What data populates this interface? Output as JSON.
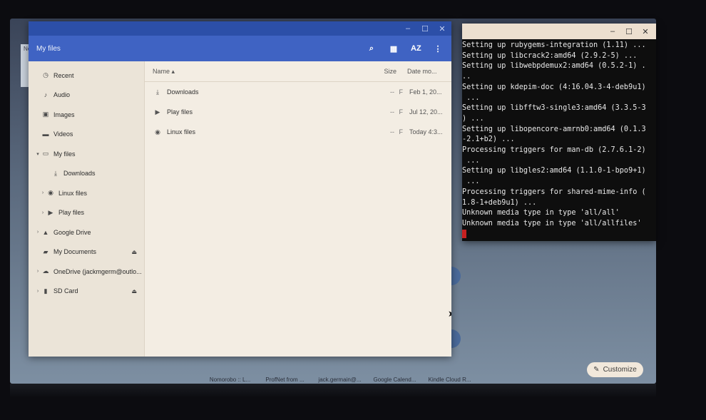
{
  "background": {
    "shelf_items": [
      "Nomorobo :: L...",
      "ProfNet from ...",
      "jack.germain@...",
      "Google Calend...",
      "Kindle Cloud R..."
    ],
    "customize_label": "Customize",
    "strip_label": "Ne"
  },
  "files_app": {
    "title": "My files",
    "window_controls": {
      "minimize": "–",
      "maximize": "☐",
      "close": "✕"
    },
    "toolbar_icons": {
      "search": "⌕",
      "grid": "▦",
      "sort": "AZ",
      "menu": "⋮"
    },
    "sidebar": [
      {
        "label": "Recent",
        "icon": "clock-icon",
        "glyph": "◷",
        "indent": 0,
        "expander": ""
      },
      {
        "label": "Audio",
        "icon": "audio-icon",
        "glyph": "♪",
        "indent": 0,
        "expander": ""
      },
      {
        "label": "Images",
        "icon": "image-icon",
        "glyph": "▣",
        "indent": 0,
        "expander": ""
      },
      {
        "label": "Videos",
        "icon": "video-icon",
        "glyph": "▬",
        "indent": 0,
        "expander": ""
      },
      {
        "label": "My files",
        "icon": "computer-icon",
        "glyph": "▭",
        "indent": 0,
        "expander": "▾",
        "selected": true
      },
      {
        "label": "Downloads",
        "icon": "download-icon",
        "glyph": "⤓",
        "indent": 2,
        "expander": ""
      },
      {
        "label": "Linux files",
        "icon": "linux-icon",
        "glyph": "◉",
        "indent": 1,
        "expander": "›"
      },
      {
        "label": "Play files",
        "icon": "play-icon",
        "glyph": "▶",
        "indent": 1,
        "expander": "›"
      },
      {
        "label": "Google Drive",
        "icon": "drive-icon",
        "glyph": "▲",
        "indent": 0,
        "expander": "›"
      },
      {
        "label": "My Documents",
        "icon": "folder-icon",
        "glyph": "▰",
        "indent": 0,
        "expander": "",
        "eject": "⏏"
      },
      {
        "label": "OneDrive (jackmgerm@outlo...",
        "icon": "cloud-icon",
        "glyph": "☁",
        "indent": 0,
        "expander": "›"
      },
      {
        "label": "SD Card",
        "icon": "sd-card-icon",
        "glyph": "▮",
        "indent": 0,
        "expander": "›",
        "eject": "⏏"
      }
    ],
    "columns": {
      "name": "Name ▴",
      "size": "Size",
      "date": "Date mo..."
    },
    "rows": [
      {
        "name": "Downloads",
        "icon": "download-icon",
        "glyph": "⤓",
        "size": "--",
        "type": "F",
        "date": "Feb 1, 20..."
      },
      {
        "name": "Play files",
        "icon": "play-icon",
        "glyph": "▶",
        "size": "--",
        "type": "F",
        "date": "Jul 12, 20..."
      },
      {
        "name": "Linux files",
        "icon": "linux-icon",
        "glyph": "◉",
        "size": "--",
        "type": "F",
        "date": "Today 4:3..."
      }
    ]
  },
  "terminal": {
    "window_controls": {
      "minimize": "–",
      "maximize": "☐",
      "close": "✕"
    },
    "lines": [
      "Setting up rubygems-integration (1.11) ...",
      "Setting up libcrack2:amd64 (2.9.2-5) ...",
      "Setting up libwebpdemux2:amd64 (0.5.2-1) .",
      "..",
      "Setting up kdepim-doc (4:16.04.3-4-deb9u1)",
      " ...",
      "Setting up libfftw3-single3:amd64 (3.3.5-3",
      ") ...",
      "Setting up libopencore-amrnb0:amd64 (0.1.3",
      "-2.1+b2) ...",
      "Processing triggers for man-db (2.7.6.1-2)",
      " ...",
      "Setting up libgles2:amd64 (1.1.0-1-bpo9+1)",
      " ...",
      "Processing triggers for shared-mime-info (",
      "1.8-1+deb9u1) ...",
      "Unknown media type in type 'all/all'",
      "Unknown media type in type 'all/allfiles'"
    ]
  }
}
